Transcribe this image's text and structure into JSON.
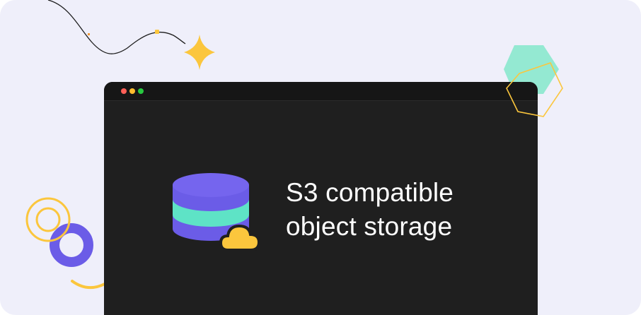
{
  "browser": {
    "window_buttons": [
      {
        "name": "close",
        "color": "#ff5f57"
      },
      {
        "name": "minimize",
        "color": "#febc2e"
      },
      {
        "name": "maximize",
        "color": "#28c840"
      }
    ]
  },
  "hero": {
    "title_line_1": "S3 compatible",
    "title_line_2": "object storage",
    "icon": "database-cloud-icon"
  },
  "colors": {
    "background": "#efeffa",
    "window": "#1f1f1f",
    "purple": "#6b5ce7",
    "teal": "#5ee3c6",
    "yellow": "#fbc63d"
  }
}
